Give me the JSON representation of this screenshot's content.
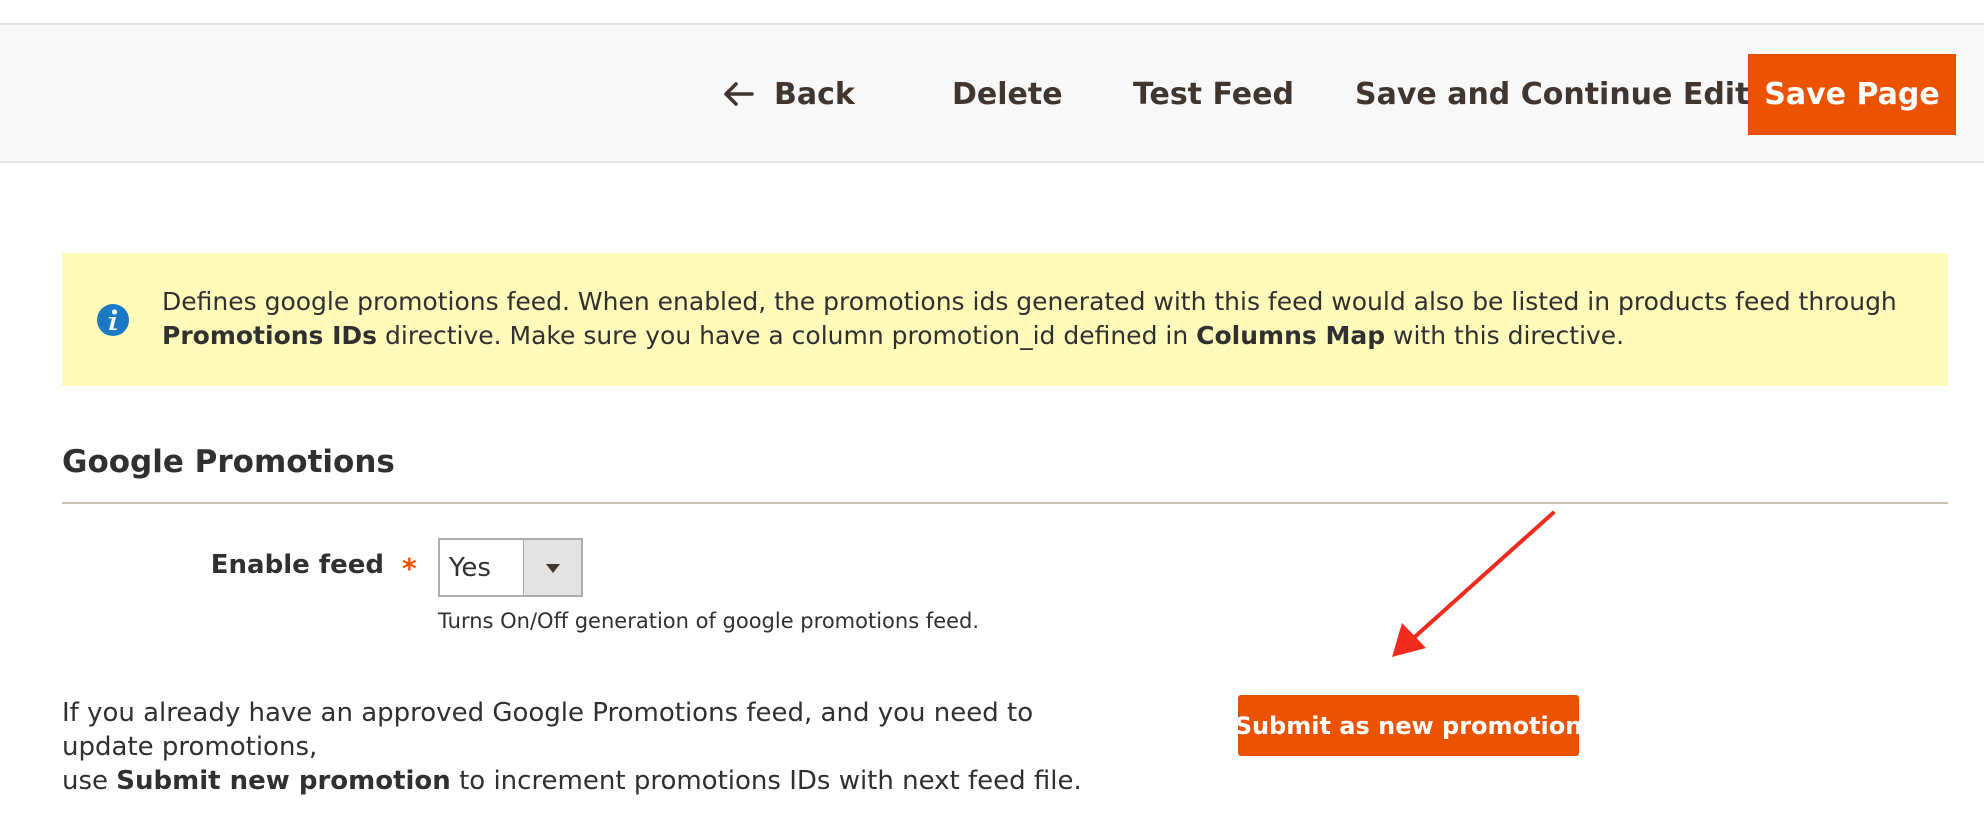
{
  "toolbar": {
    "back_label": "Back",
    "delete_label": "Delete",
    "test_feed_label": "Test Feed",
    "save_continue_label": "Save and Continue Edit",
    "save_page_label": "Save Page"
  },
  "notice": {
    "icon": "info-icon",
    "part1": "Defines google promotions feed. When enabled, the promotions ids generated with this feed would also be listed in products feed through ",
    "bold1": "Promotions IDs",
    "part2": " directive. Make sure you have a column promotion_id defined in ",
    "bold2": "Columns Map",
    "part3": " with this directive."
  },
  "section": {
    "title": "Google Promotions"
  },
  "enable_feed": {
    "label": "Enable feed",
    "required_mark": "*",
    "selected_value": "Yes",
    "note": "Turns On/Off generation of google promotions feed."
  },
  "explanation": {
    "line1": "If you already have an approved Google Promotions feed, and you need to update promotions,",
    "line2_prefix": "use ",
    "line2_bold": "Submit new promotion",
    "line2_suffix": " to increment promotions IDs with next feed file."
  },
  "submit_button": {
    "label": "Submit as new promotion"
  },
  "colors": {
    "accent": "#eb5202",
    "notice_bg": "#fffbbb",
    "info_icon": "#1979c3",
    "annotation_arrow": "#f02b1d"
  }
}
